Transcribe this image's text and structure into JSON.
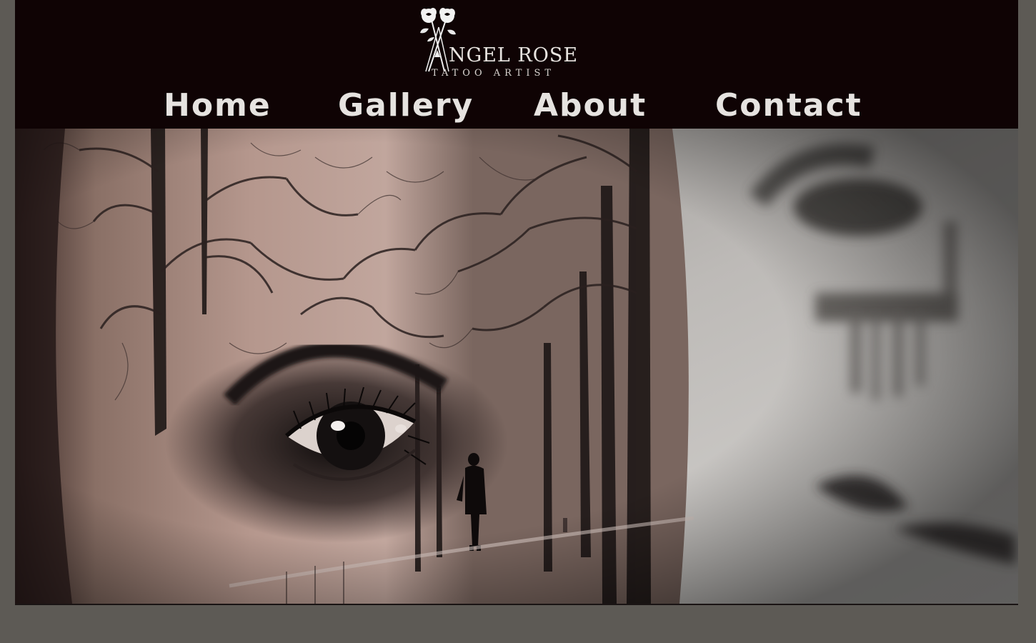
{
  "brand": {
    "name": "NGEL ROSE",
    "tagline": "TATOO ARTIST"
  },
  "nav": {
    "items": [
      {
        "label": "Home"
      },
      {
        "label": "Gallery"
      },
      {
        "label": "About"
      },
      {
        "label": "Contact"
      }
    ]
  },
  "hero": {
    "image_alt": "black and grey tattoo of a woman's eye with bare trees and a lone walking figure"
  },
  "colors": {
    "page_background": "#5d5a55",
    "header_background": "#0f0304",
    "nav_text": "#e6e3e0"
  }
}
